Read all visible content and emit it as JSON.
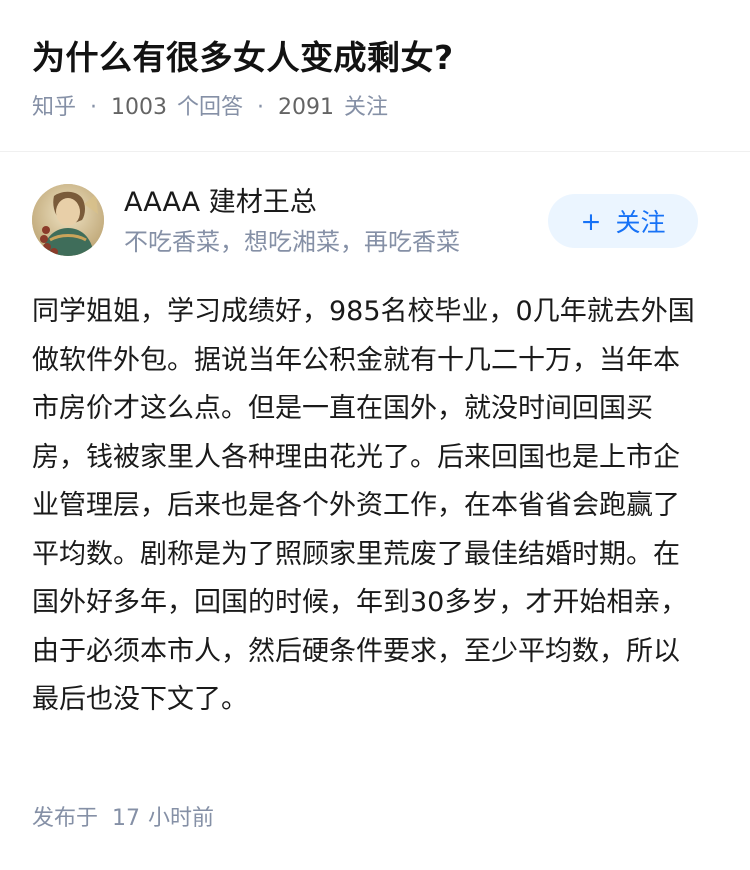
{
  "question": {
    "title": "为什么有很多女人变成剩女?",
    "source": "知乎",
    "answer_count": "1003",
    "answer_unit": "个回答",
    "follower_count": "2091",
    "follower_unit": "关注"
  },
  "author": {
    "name": "AAAA 建材王总",
    "bio": "不吃香菜，想吃湘菜，再吃香菜",
    "avatar_icon": "avatar-image",
    "follow_label": "关注",
    "follow_icon": "plus-icon",
    "accent_color": "#1772f6",
    "follow_bg_color": "#ebf5ff"
  },
  "answer": {
    "content": "同学姐姐，学习成绩好，985名校毕业，0几年就去外国做软件外包。据说当年公积金就有十几二十万，当年本市房价才这么点。但是一直在国外，就没时间回国买房，钱被家里人各种理由花光了。后来回国也是上市企业管理层，后来也是各个外资工作，在本省省会跑赢了平均数。剧称是为了照顾家里荒废了最佳结婚时期。在国外好多年，回国的时候，年到30多岁，才开始相亲，由于必须本市人，然后硬条件要求，至少平均数，所以最后也没下文了。",
    "published_prefix": "发布于",
    "published_num": "17",
    "published_suffix": "小时前"
  },
  "colors": {
    "meta_gray": "#8590a6",
    "text": "#1a1a1a"
  }
}
